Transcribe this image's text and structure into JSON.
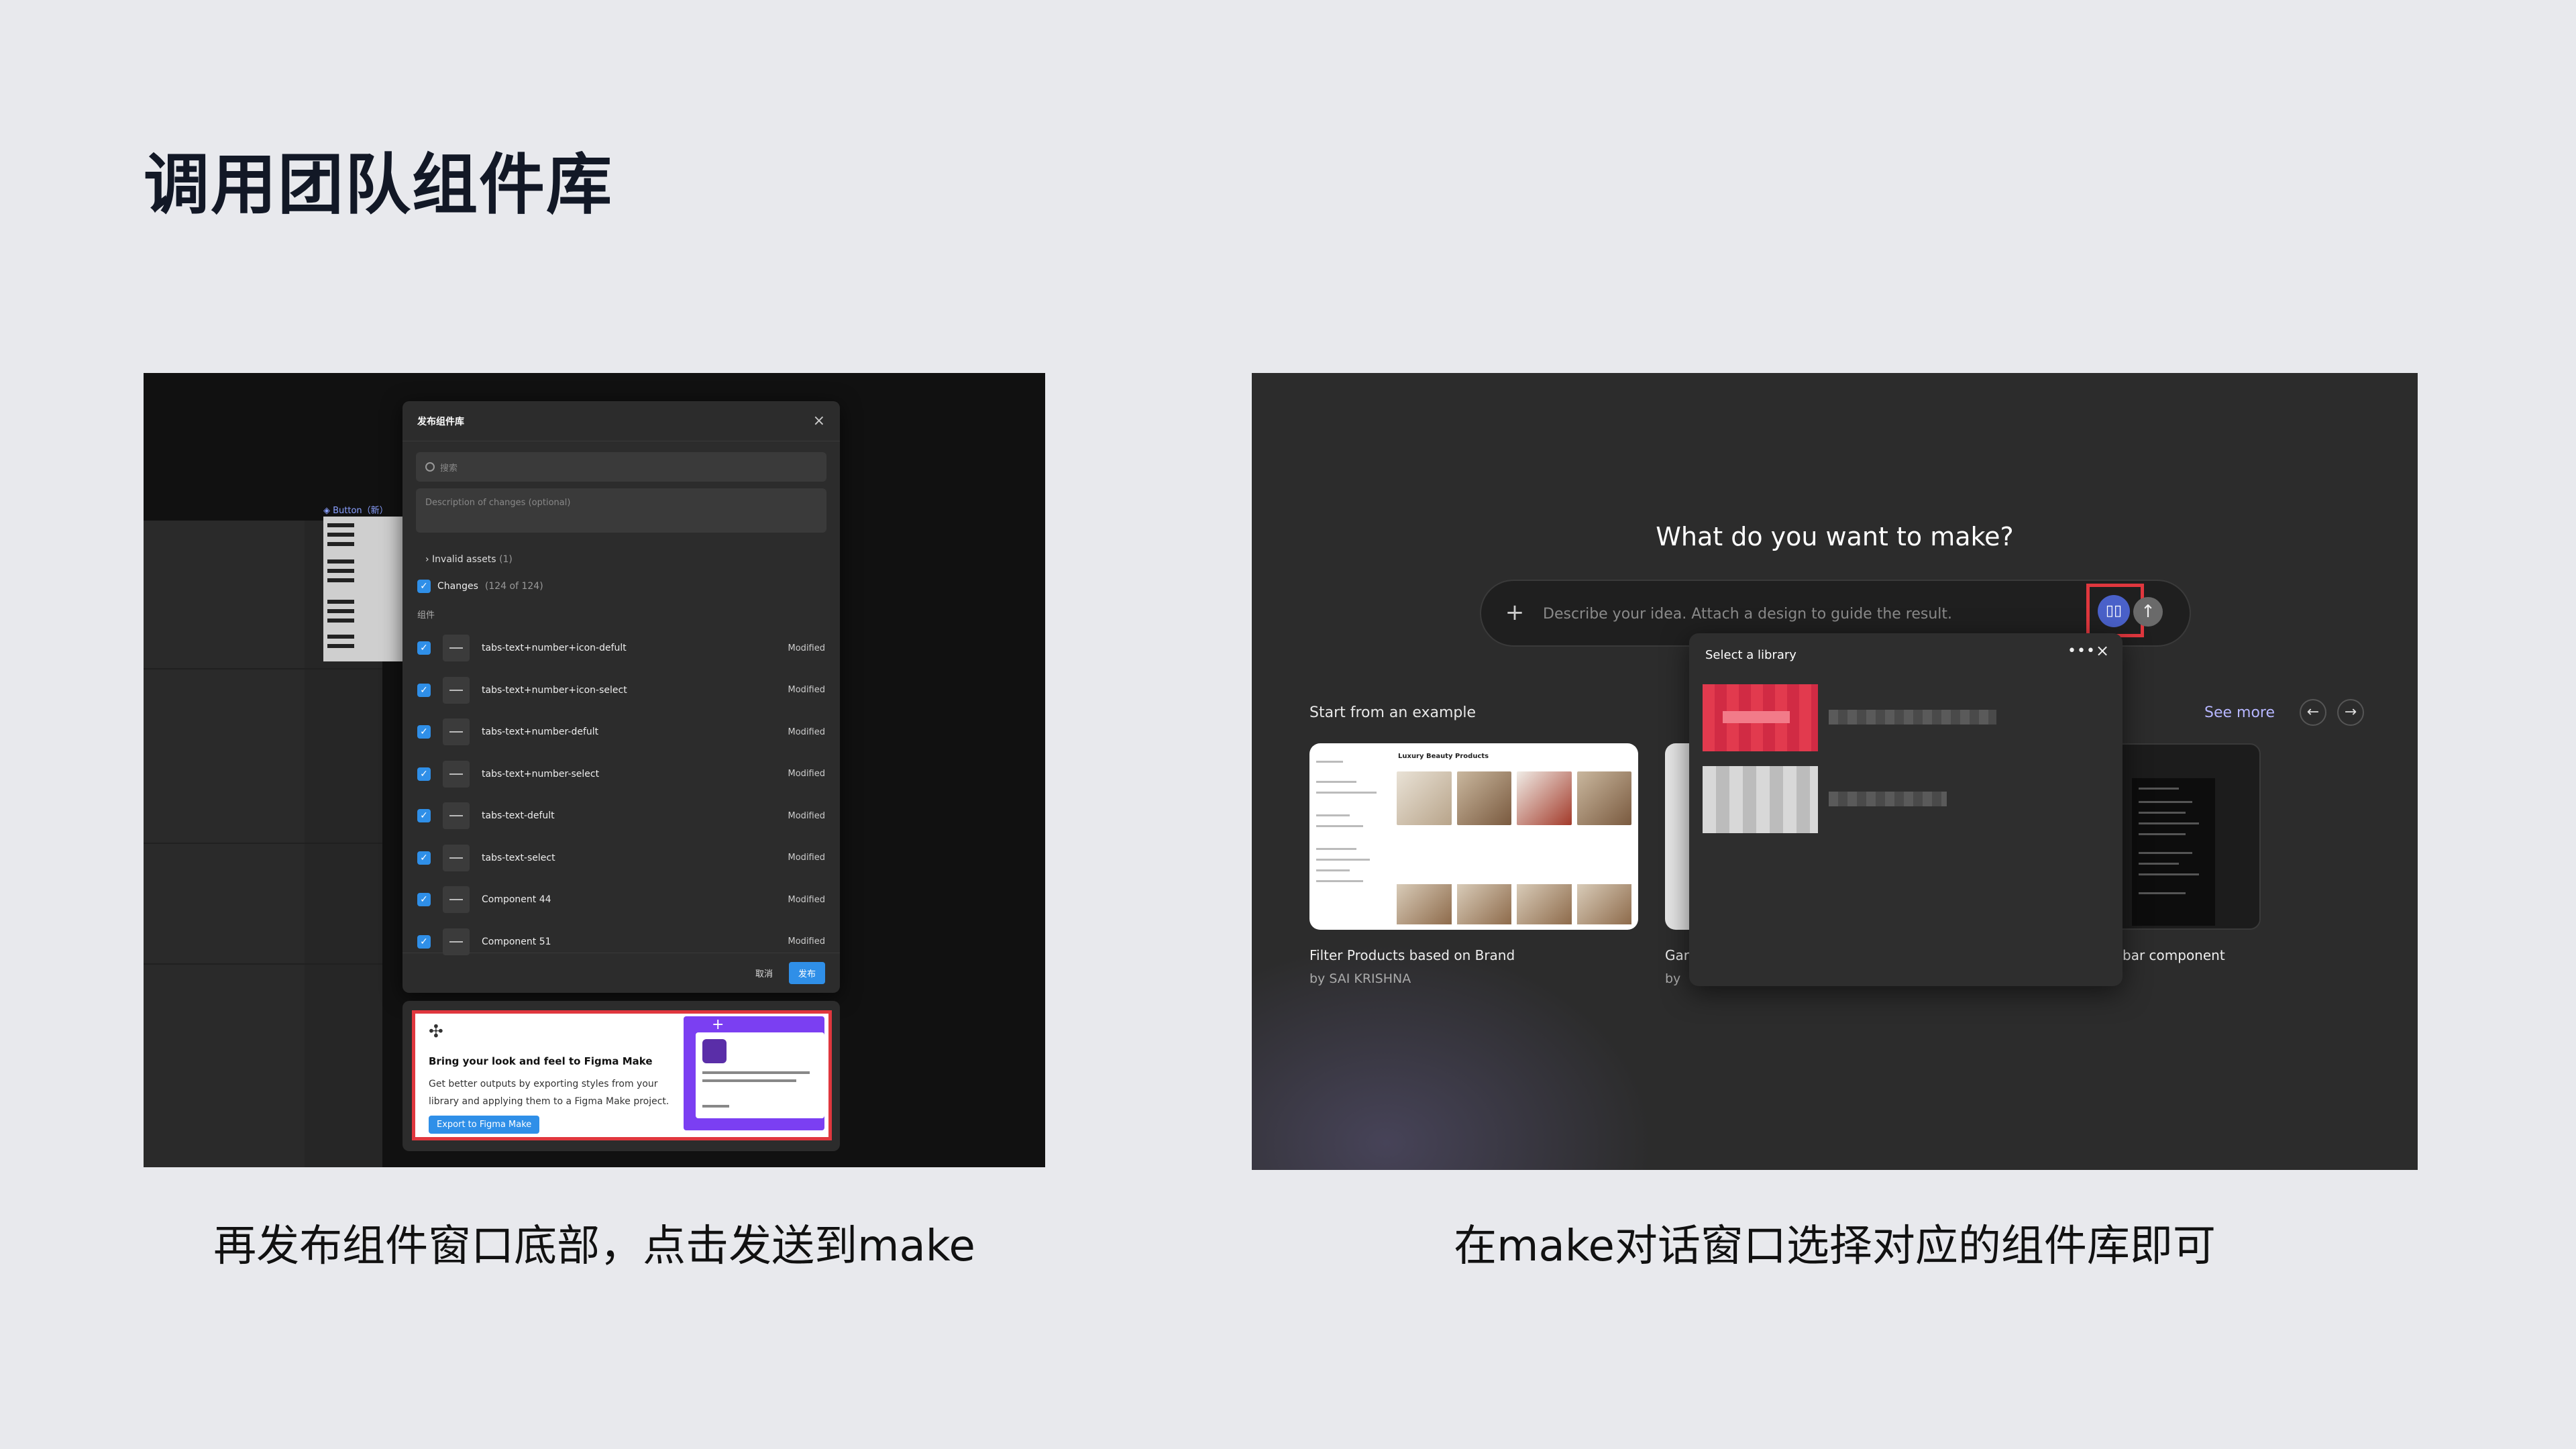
{
  "slide": {
    "title": "调用团队组件库",
    "caption_left": "再发布组件窗口底部，点击发送到make",
    "caption_right": "在make对话窗口选择对应的组件库即可"
  },
  "left": {
    "bg_component_label": "◈ Button（新）",
    "publish_panel": {
      "title": "发布组件库",
      "close": "×",
      "search_placeholder": "搜索",
      "description_placeholder": "Description of changes (optional)",
      "invalid_assets": "› Invalid assets",
      "invalid_count": "(1)",
      "changes_label": "Changes",
      "changes_count": "(124 of 124)",
      "section_label": "组件",
      "items": [
        {
          "name": "tabs-text+number+icon-defult",
          "status": "Modified"
        },
        {
          "name": "tabs-text+number+icon-select",
          "status": "Modified"
        },
        {
          "name": "tabs-text+number-defult",
          "status": "Modified"
        },
        {
          "name": "tabs-text+number-select",
          "status": "Modified"
        },
        {
          "name": "tabs-text-defult",
          "status": "Modified"
        },
        {
          "name": "tabs-text-select",
          "status": "Modified"
        },
        {
          "name": "Component 44",
          "status": "Modified"
        },
        {
          "name": "Component 51",
          "status": "Modified"
        }
      ],
      "cancel": "取消",
      "publish": "发布"
    },
    "make_card": {
      "heading": "Bring your look and feel to Figma Make",
      "body": "Get better outputs by exporting styles from your library and applying them to a Figma Make project.",
      "button": "Export to Figma Make"
    }
  },
  "right": {
    "question": "What do you want to make?",
    "prompt_placeholder": "Describe your idea. Attach a design to guide the result.",
    "start_label": "Start from an example",
    "see_more": "See more",
    "card1": {
      "title": "Filter Products based on Brand",
      "author": "by SAI KRISHNA",
      "inner_title": "Luxury Beauty Products"
    },
    "card2": {
      "title": "Gar",
      "author": "by"
    },
    "card3": {
      "title": "bar component"
    },
    "library_popup": {
      "title": "Select a library",
      "more": "•••",
      "close": "×"
    },
    "accent_color": "#e0373e",
    "library_icon_color": "#4a61c9"
  }
}
